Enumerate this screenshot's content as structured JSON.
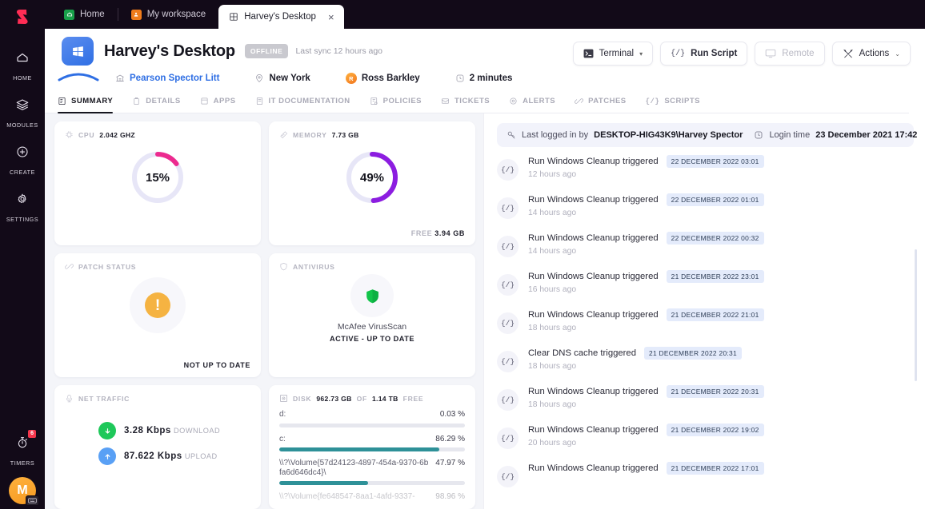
{
  "rail": {
    "logo_icon": "syncro-s-logo",
    "items": [
      {
        "label": "HOME",
        "icon": "home-icon"
      },
      {
        "label": "MODULES",
        "icon": "layers-icon"
      },
      {
        "label": "CREATE",
        "icon": "plus-circle-icon"
      },
      {
        "label": "SETTINGS",
        "icon": "gear-icon"
      }
    ],
    "timers": {
      "label": "TIMERS",
      "icon": "stopwatch-icon",
      "badge": "6"
    },
    "avatar": {
      "initial": "M",
      "sub_icon": "keyboard-icon"
    }
  },
  "topbar": {
    "tabs": [
      {
        "label": "Home",
        "icon": "home-tile-icon",
        "active": false
      },
      {
        "label": "My workspace",
        "icon": "workspace-tile-icon",
        "active": false
      },
      {
        "label": "Harvey's Desktop",
        "icon": "windows-grid-icon",
        "active": true,
        "close": "×"
      }
    ]
  },
  "header": {
    "os_icon": "windows-logo",
    "title": "Harvey's Desktop",
    "status_badge": "OFFLINE",
    "sync_text": "Last sync 12 hours ago",
    "meta": [
      {
        "icon": "building-icon",
        "label": "Pearson Spector Litt",
        "link": true
      },
      {
        "icon": "location-pin-icon",
        "label": "New York",
        "link": false
      },
      {
        "icon": "avatar-initial",
        "initial": "R",
        "label": "Ross Barkley",
        "link": false
      },
      {
        "icon": "clock-icon",
        "label": "2 minutes",
        "link": false
      }
    ],
    "actions": [
      {
        "label": "Terminal",
        "icon": "terminal-icon",
        "caret": "▾",
        "muted": false,
        "bold": false
      },
      {
        "label": "Run Script",
        "icon": "script-braces-icon",
        "caret": "",
        "muted": false,
        "bold": true
      },
      {
        "label": "Remote",
        "icon": "monitor-icon",
        "caret": "",
        "muted": true,
        "bold": false
      },
      {
        "label": "Actions",
        "icon": "tools-icon",
        "caret": "⌄",
        "muted": false,
        "bold": false
      }
    ]
  },
  "tabs": [
    {
      "label": "SUMMARY",
      "icon": "summary-icon",
      "active": true
    },
    {
      "label": "DETAILS",
      "icon": "details-icon",
      "active": false
    },
    {
      "label": "APPS",
      "icon": "apps-icon",
      "active": false
    },
    {
      "label": "IT DOCUMENTATION",
      "icon": "document-icon",
      "active": false
    },
    {
      "label": "POLICIES",
      "icon": "policies-icon",
      "active": false
    },
    {
      "label": "TICKETS",
      "icon": "tickets-icon",
      "active": false
    },
    {
      "label": "ALERTS",
      "icon": "alerts-icon",
      "active": false
    },
    {
      "label": "PATCHES",
      "icon": "patches-icon",
      "active": false
    },
    {
      "label": "SCRIPTS",
      "icon": "scripts-icon",
      "active": false
    }
  ],
  "cards": {
    "cpu": {
      "icon": "cpu-chip-icon",
      "label": "CPU",
      "value": "2.042 GHz",
      "percent_text": "15%",
      "percent": 15,
      "color": "#ec2a8f",
      "track": "#e7e6f7"
    },
    "memory": {
      "icon": "ram-stick-icon",
      "label": "MEMORY",
      "value": "7.73 GB",
      "percent_text": "49%",
      "percent": 49,
      "color": "#8c1de0",
      "track": "#e7e6f7",
      "footer_label": "FREE",
      "footer_value": "3.94 GB"
    },
    "patch": {
      "icon": "patch-link-icon",
      "label": "PATCH STATUS",
      "glyph": "!",
      "glyph_color": "#f5b342",
      "footer_label": "NOT UP TO DATE"
    },
    "antivirus": {
      "icon": "shield-icon",
      "label": "ANTIVIRUS",
      "shield_color": "#12c44a",
      "product": "McAfee VirusScan",
      "state": "ACTIVE  -  UP TO DATE"
    },
    "net": {
      "icon": "network-icon",
      "label": "NET TRAFFIC",
      "download": {
        "icon": "arrow-down-icon",
        "value": "3.28 Kbps",
        "unit": "DOWNLOAD"
      },
      "upload": {
        "icon": "arrow-up-icon",
        "value": "87.622 Kbps",
        "unit": "UPLOAD"
      }
    },
    "disk": {
      "icon": "disk-icon",
      "label": "DISK",
      "free": "962.73 GB",
      "of": "OF",
      "total": "1.14 TB",
      "free_word": "FREE",
      "volumes": [
        {
          "name": "d:",
          "pct_text": "0.03 %",
          "pct": 0.03
        },
        {
          "name": "c:",
          "pct_text": "86.29 %",
          "pct": 86.29
        },
        {
          "name": "\\\\?\\Volume{57d24123-4897-454a-9370-6bfa6d646dc4}\\",
          "pct_text": "47.97 %",
          "pct": 47.97
        },
        {
          "name": "\\\\?\\Volume{fe648547-8aa1-4afd-9337-",
          "pct_text": "98.96 %",
          "pct": 98.96
        }
      ]
    }
  },
  "activity": {
    "login": {
      "key_icon": "key-icon",
      "prefix": "Last logged in by",
      "user": "DESKTOP-HIG43K9\\Harvey Spector",
      "clock_icon": "clock-icon",
      "time_label": "Login time",
      "time_value": "23 December 2021 17:42"
    },
    "items": [
      {
        "icon": "script-braces-icon",
        "title": "Run Windows Cleanup triggered",
        "chip": "22 DECEMBER 2022 03:01",
        "ago": "12 hours ago"
      },
      {
        "icon": "script-braces-icon",
        "title": "Run Windows Cleanup triggered",
        "chip": "22 DECEMBER 2022 01:01",
        "ago": "14 hours ago"
      },
      {
        "icon": "script-braces-icon",
        "title": "Run Windows Cleanup triggered",
        "chip": "22 DECEMBER 2022 00:32",
        "ago": "14 hours ago"
      },
      {
        "icon": "script-braces-icon",
        "title": "Run Windows Cleanup triggered",
        "chip": "21 DECEMBER 2022 23:01",
        "ago": "16 hours ago"
      },
      {
        "icon": "script-braces-icon",
        "title": "Run Windows Cleanup triggered",
        "chip": "21 DECEMBER 2022 21:01",
        "ago": "18 hours ago"
      },
      {
        "icon": "script-braces-icon",
        "title": "Clear DNS cache triggered",
        "chip": "21 DECEMBER 2022 20:31",
        "ago": "18 hours ago"
      },
      {
        "icon": "script-braces-icon",
        "title": "Run Windows Cleanup triggered",
        "chip": "21 DECEMBER 2022 20:31",
        "ago": "18 hours ago"
      },
      {
        "icon": "script-braces-icon",
        "title": "Run Windows Cleanup triggered",
        "chip": "21 DECEMBER 2022 19:02",
        "ago": "20 hours ago"
      },
      {
        "icon": "script-braces-icon",
        "title": "Run Windows Cleanup triggered",
        "chip": "21 DECEMBER 2022 17:01",
        "ago": ""
      }
    ]
  }
}
